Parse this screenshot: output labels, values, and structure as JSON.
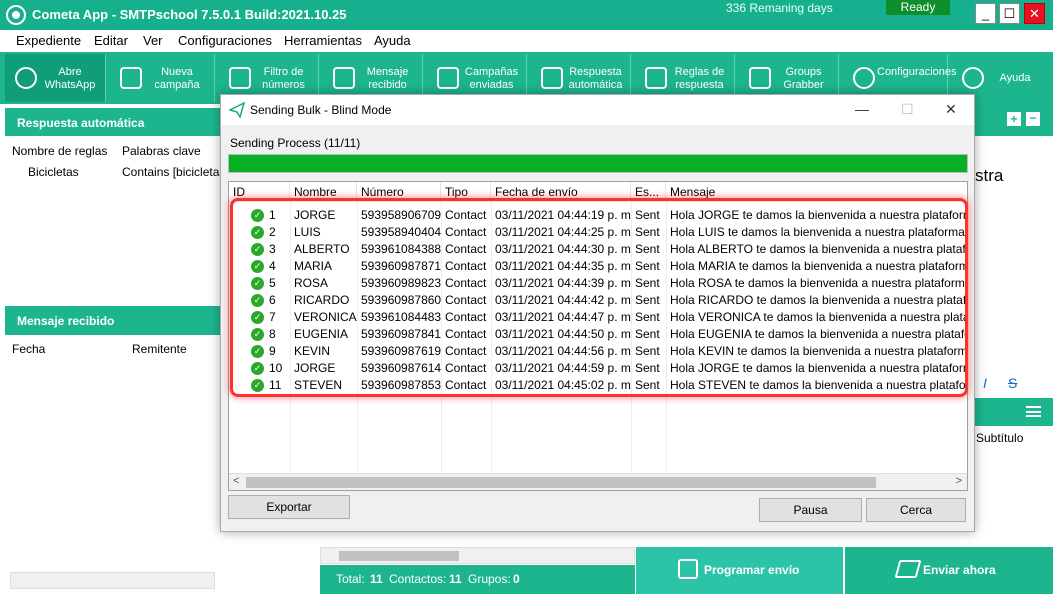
{
  "window": {
    "title": "Cometa App - SMTPschool 7.5.0.1 Build:2021.10.25",
    "remaining": "336 Remaning days",
    "status": "Ready",
    "controls": [
      "_",
      "☐",
      "✕"
    ]
  },
  "menu": [
    "Expediente",
    "Editar",
    "Ver",
    "Configuraciones",
    "Herramientas",
    "Ayuda"
  ],
  "toolbar": [
    {
      "label": "Abre WhatsApp",
      "icon": "whatsapp-icon"
    },
    {
      "label": "Nueva campaña",
      "icon": "megaphone-icon"
    },
    {
      "label": "Filtro de números",
      "icon": "filter-icon"
    },
    {
      "label": "Mensaje recibido",
      "icon": "mail-icon"
    },
    {
      "label": "Campañas enviadas",
      "icon": "campaigns-icon"
    },
    {
      "label": "Respuesta automática",
      "icon": "auto-reply-icon"
    },
    {
      "label": "Reglas de respuesta",
      "icon": "rules-icon"
    },
    {
      "label": "Groups Grabber",
      "icon": "groups-icon"
    },
    {
      "label": "Configuraciones",
      "icon": "gear-icon"
    },
    {
      "label": "Ayuda",
      "icon": "help-icon"
    }
  ],
  "left_panel": {
    "auto_reply_title": "Respuesta automática",
    "rules_col": "Nombre de reglas",
    "keywords_col": "Palabras clave",
    "rule_name": "Bicicletas",
    "rule_keywords": "Contains [bicicletas]",
    "received_title": "Mensaje recibido",
    "date_col": "Fecha",
    "sender_col": "Remitente"
  },
  "right_panel": {
    "partial_text": "stra",
    "format_italic": "I",
    "format_strike": "S",
    "subtitle": "Subtítulo"
  },
  "footer": {
    "total_label": "Total:",
    "total": "11",
    "contacts_label": "Contactos:",
    "contacts": "11",
    "groups_label": "Grupos:",
    "groups": "0",
    "schedule_button": "Programar envío",
    "send_now_button": "Enviar ahora"
  },
  "dialog": {
    "title": "Sending Bulk - Blind Mode",
    "progress_label": "Sending Process (11/11)",
    "progress_fraction": 1.0,
    "columns": [
      "ID",
      "Nombre",
      "Número",
      "Tipo",
      "Fecha de envío",
      "Es...",
      "Mensaje"
    ],
    "rows": [
      {
        "id": "1",
        "name": "JORGE",
        "number": "593958906709",
        "type": "Contact",
        "date": "03/11/2021 04:44:19 p. m.",
        "status": "Sent",
        "message": "Hola JORGE te damos la bienvenida a nuestra plataforma de M"
      },
      {
        "id": "2",
        "name": "LUIS",
        "number": "593958940404",
        "type": "Contact",
        "date": "03/11/2021 04:44:25 p. m.",
        "status": "Sent",
        "message": "Hola LUIS te damos la bienvenida a nuestra plataforma de Mar"
      },
      {
        "id": "3",
        "name": "ALBERTO",
        "number": "593961084388",
        "type": "Contact",
        "date": "03/11/2021 04:44:30 p. m.",
        "status": "Sent",
        "message": "Hola ALBERTO te damos la bienvenida a nuestra plataforma d"
      },
      {
        "id": "4",
        "name": "MARIA",
        "number": "593960987871",
        "type": "Contact",
        "date": "03/11/2021 04:44:35 p. m.",
        "status": "Sent",
        "message": "Hola MARIA te damos la bienvenida a nuestra plataforma de M"
      },
      {
        "id": "5",
        "name": "ROSA",
        "number": "593960989823",
        "type": "Contact",
        "date": "03/11/2021 04:44:39 p. m.",
        "status": "Sent",
        "message": "Hola ROSA te damos la bienvenida a nuestra plataforma de Ma"
      },
      {
        "id": "6",
        "name": "RICARDO",
        "number": "593960987860",
        "type": "Contact",
        "date": "03/11/2021 04:44:42 p. m.",
        "status": "Sent",
        "message": "Hola RICARDO te damos la bienvenida a nuestra plataforma d"
      },
      {
        "id": "7",
        "name": "VERONICA",
        "number": "593961084483",
        "type": "Contact",
        "date": "03/11/2021 04:44:47 p. m.",
        "status": "Sent",
        "message": "Hola VERONICA te damos la bienvenida a nuestra plataforma"
      },
      {
        "id": "8",
        "name": "EUGENIA",
        "number": "593960987841",
        "type": "Contact",
        "date": "03/11/2021 04:44:50 p. m.",
        "status": "Sent",
        "message": "Hola EUGENIA te damos la bienvenida a nuestra plataforma d"
      },
      {
        "id": "9",
        "name": "KEVIN",
        "number": "593960987619",
        "type": "Contact",
        "date": "03/11/2021 04:44:56 p. m.",
        "status": "Sent",
        "message": "Hola KEVIN te damos la bienvenida a nuestra plataforma de M"
      },
      {
        "id": "10",
        "name": "JORGE",
        "number": "593960987614",
        "type": "Contact",
        "date": "03/11/2021 04:44:59 p. m.",
        "status": "Sent",
        "message": "Hola JORGE te damos la bienvenida a nuestra plataforma de M"
      },
      {
        "id": "11",
        "name": "STEVEN",
        "number": "593960987853",
        "type": "Contact",
        "date": "03/11/2021 04:45:02 p. m.",
        "status": "Sent",
        "message": "Hola STEVEN te damos la bienvenida a nuestra plataforma de"
      }
    ],
    "export_button": "Exportar",
    "pause_button": "Pausa",
    "close_button": "Cerca"
  },
  "colors": {
    "brand": "#1db58e",
    "progress": "#06b025",
    "highlight": "#ff3030",
    "close": "#e81123"
  }
}
